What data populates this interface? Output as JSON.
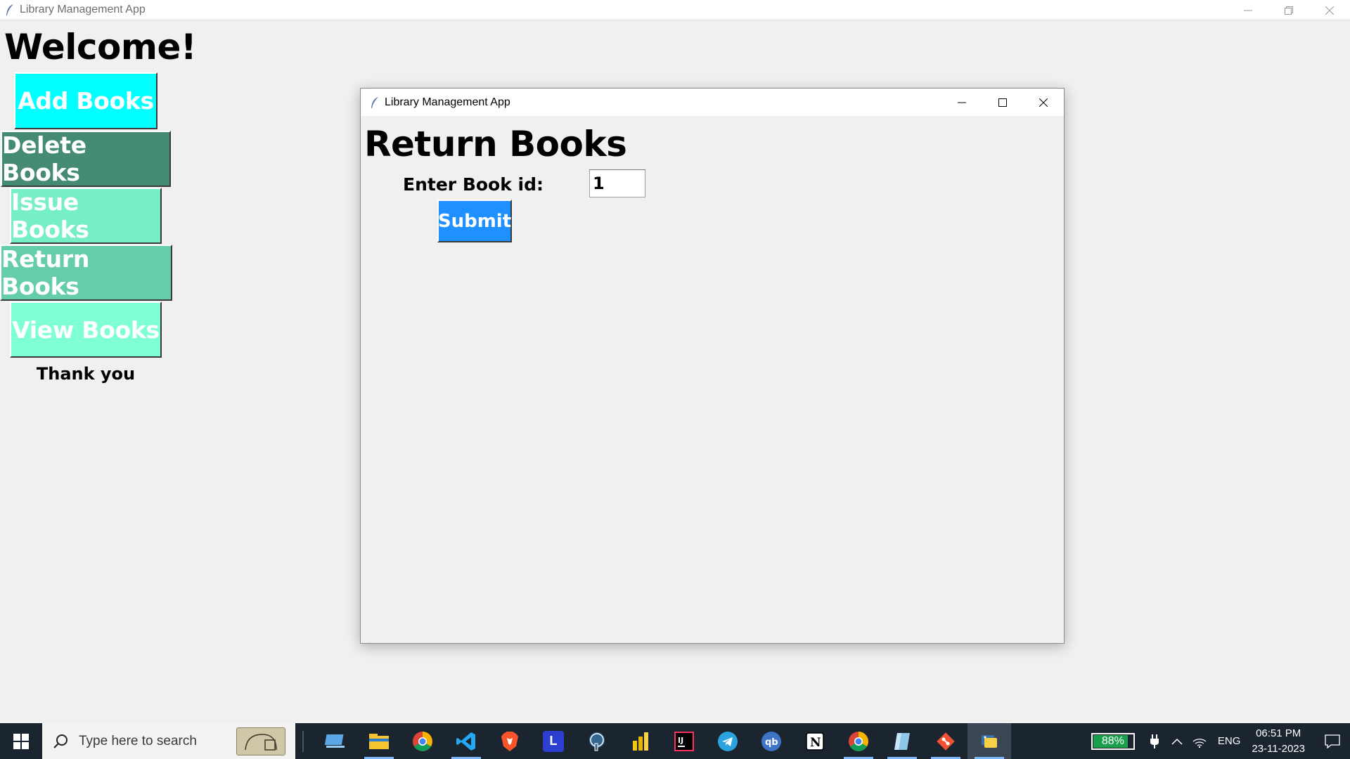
{
  "main_window": {
    "title": "Library Management App",
    "welcome": "Welcome!",
    "buttons": {
      "add": "Add Books",
      "delete": "Delete Books",
      "issue": "Issue Books",
      "return": "Return Books",
      "view": "View Books"
    },
    "thank_you": "Thank you"
  },
  "dialog": {
    "title": "Library Management App",
    "heading": "Return Books",
    "book_id_label": "Enter Book id:",
    "book_id_value": "1",
    "submit": "Submit"
  },
  "taskbar": {
    "search_placeholder": "Type here to search",
    "apps": [
      "desktop-icon",
      "file-explorer-icon",
      "chrome-icon",
      "vscode-icon",
      "brave-icon",
      "l-app-icon",
      "postgres-icon",
      "power-bi-icon",
      "intellij-icon",
      "telegram-icon",
      "qbittorrent-icon",
      "notion-icon",
      "chrome-icon",
      "app-icon",
      "git-icon",
      "python-icon"
    ],
    "battery_percent": "88%",
    "battery_level": 0.88,
    "language": "ENG",
    "time": "06:51 PM",
    "date": "23-11-2023"
  },
  "colors": {
    "add_button": "#00ffff",
    "delete_button": "#458b74",
    "issue_button": "#76eec6",
    "return_button": "#66cdaa",
    "view_button": "#7fffd4",
    "submit_button": "#1e90ff",
    "taskbar": "#1b2530"
  }
}
